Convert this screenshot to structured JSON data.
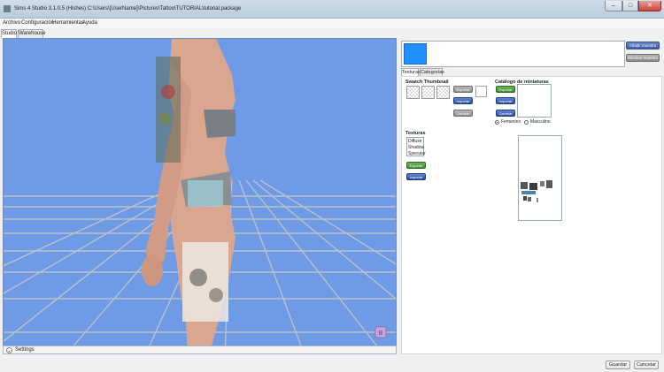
{
  "window": {
    "title": "Sims 4 Studio 3.1.0.5 (Hishes)  C:\\Users\\[UserName]\\Pictures\\Tattoo\\TUTORIAL\\tutorial.package",
    "minimize": "–",
    "maximize": "□",
    "close": "✕"
  },
  "menu": [
    "Archivo",
    "Configuración",
    "Herramientas",
    "Ayuda"
  ],
  "main_tabs": [
    "Studio",
    "Warehouse"
  ],
  "viewport": {
    "settings_label": "Settings",
    "badge": "B",
    "background_color": "#6f9be6",
    "grid_color": "#b9c2cc"
  },
  "right": {
    "add_button": "Añadir muestra",
    "remove_button": "Eliminar muestra",
    "tabs": [
      "Texturas",
      "Categorías"
    ],
    "swatch_thumbnail": {
      "title": "Swatch Thumbnail",
      "exportar": "Exportar",
      "importar": "Importar",
      "cambiar": "Cambiar"
    },
    "catalog": {
      "title": "Catálogo de miniaturas",
      "exportar": "Exportar",
      "importar": "Importar",
      "cambiar": "Cambiar",
      "femenino": "Femenino",
      "masculino": "Masculino",
      "selected": "Femenino"
    },
    "textures": {
      "title": "Texturas",
      "items": [
        "Diffuse",
        "Shadow",
        "Specular"
      ],
      "exportar": "Exportar",
      "importar": "Importar"
    }
  },
  "footer": {
    "save": "Guardar",
    "cancel": "Cancelar"
  }
}
